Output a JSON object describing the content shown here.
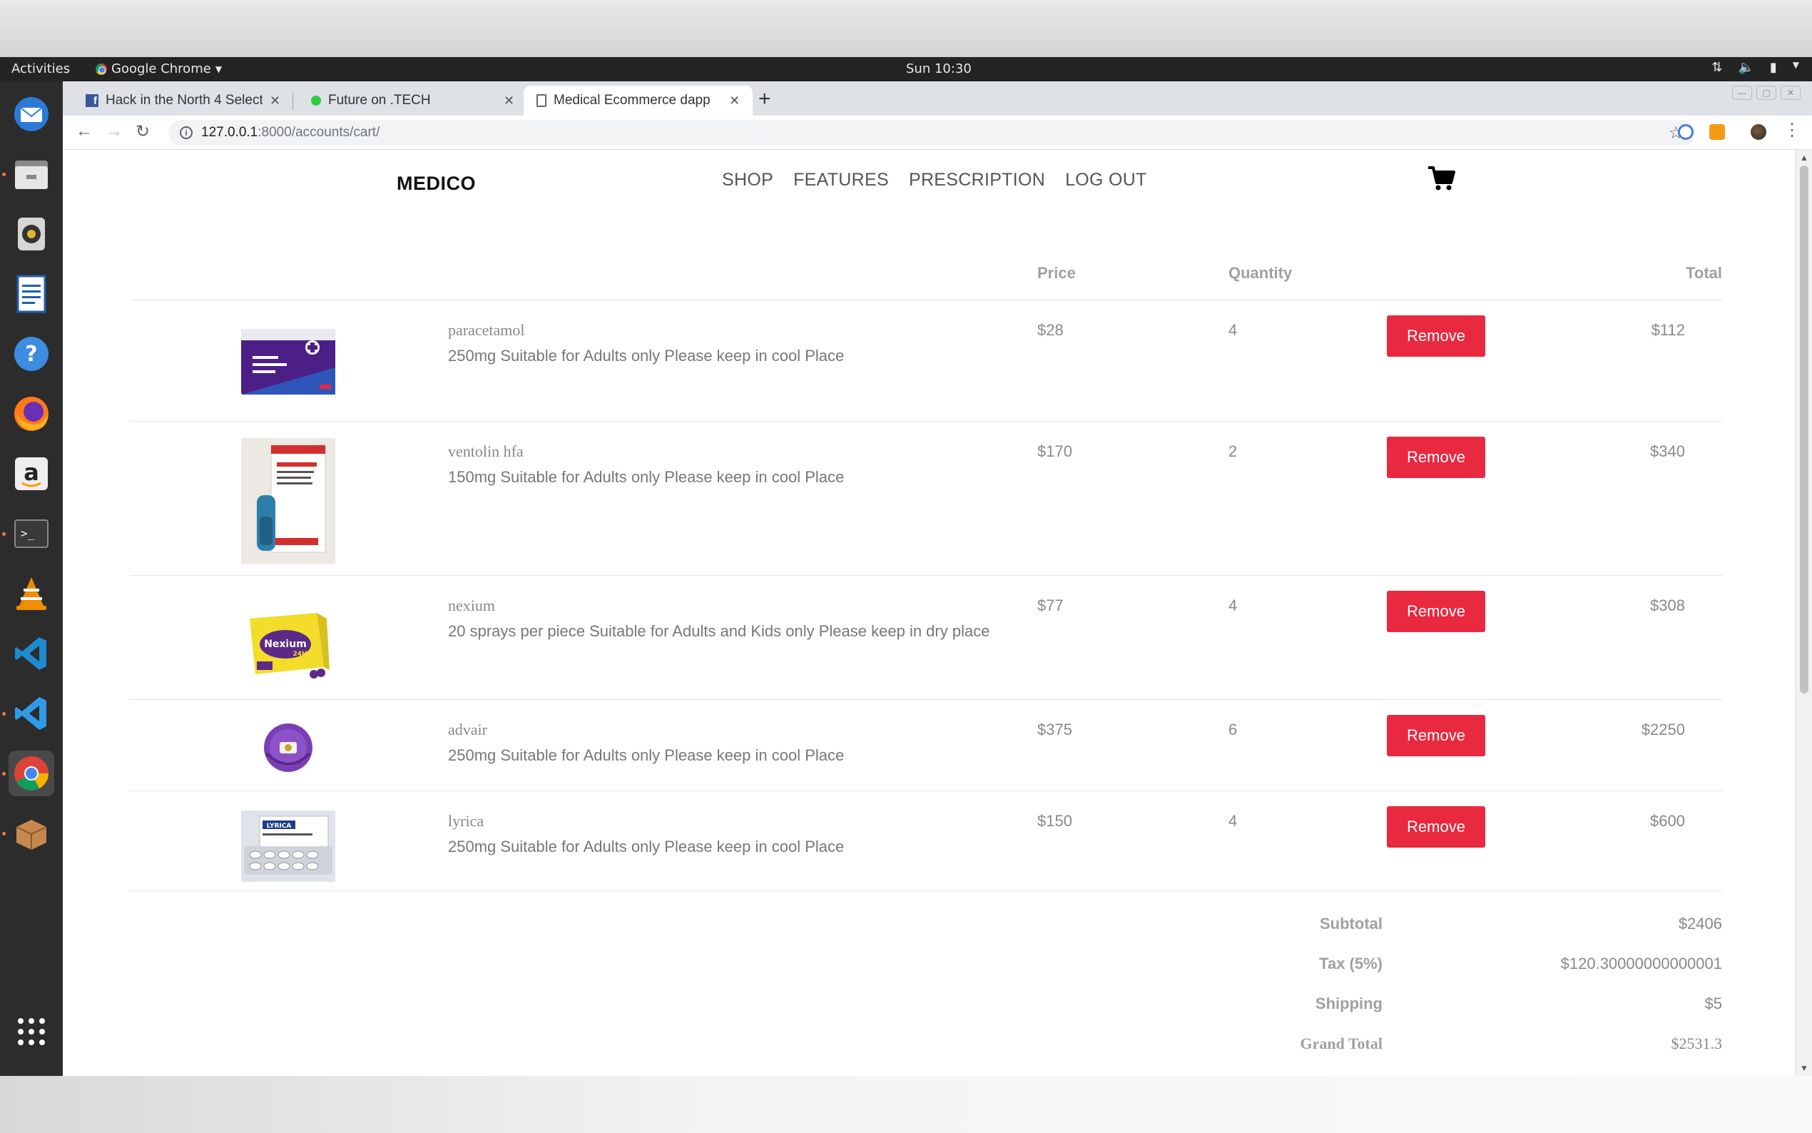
{
  "os": {
    "activities_label": "Activities",
    "app_menu_label": "Google Chrome",
    "clock": "Sun 10:30"
  },
  "dock": {
    "items": [
      "thunderbird-icon",
      "files-icon",
      "rhythmbox-icon",
      "libreoffice-writer-icon",
      "help-icon",
      "firefox-icon",
      "amazon-icon",
      "terminal-icon",
      "vlc-icon",
      "vscode-icon",
      "vscode-insiders-icon",
      "chrome-icon",
      "package-icon",
      "show-apps-icon"
    ]
  },
  "browser": {
    "tabs": [
      {
        "title": "Hack in the North 4 Select",
        "favicon": "facebook-icon"
      },
      {
        "title": "Future on .TECH",
        "favicon": "green-dot-icon"
      },
      {
        "title": "Medical Ecommerce dapp",
        "favicon": "document-icon"
      }
    ],
    "url_host": "127.0.0.1",
    "url_path": ":8000/accounts/cart/"
  },
  "site": {
    "brand": "MEDICO",
    "nav": [
      "SHOP",
      "FEATURES",
      "PRESCRIPTION",
      "LOG OUT"
    ],
    "cart_icon": "shopping-cart-icon"
  },
  "cart": {
    "headers": {
      "price": "Price",
      "quantity": "Quantity",
      "total": "Total"
    },
    "remove_label": "Remove",
    "items": [
      {
        "name": "paracetamol",
        "description": "250mg Suitable for Adults only Please keep in cool Place",
        "price": "$28",
        "quantity": "4",
        "total": "$112",
        "image": "paracetamol-box"
      },
      {
        "name": "ventolin hfa",
        "description": "150mg Suitable for Adults only Please keep in cool Place",
        "price": "$170",
        "quantity": "2",
        "total": "$340",
        "image": "ventolin-inhaler"
      },
      {
        "name": "nexium",
        "description": "20 sprays per piece Suitable for Adults and Kids only Please keep in dry place",
        "price": "$77",
        "quantity": "4",
        "total": "$308",
        "image": "nexium-box"
      },
      {
        "name": "advair",
        "description": "250mg Suitable for Adults only Please keep in cool Place",
        "price": "$375",
        "quantity": "6",
        "total": "$2250",
        "image": "advair-diskus"
      },
      {
        "name": "lyrica",
        "description": "250mg Suitable for Adults only Please keep in cool Place",
        "price": "$150",
        "quantity": "4",
        "total": "$600",
        "image": "lyrica-box"
      }
    ],
    "summary": {
      "subtotal_label": "Subtotal",
      "subtotal": "$2406",
      "tax_label": "Tax (5%)",
      "tax": "$120.30000000000001",
      "shipping_label": "Shipping",
      "shipping": "$5",
      "grand_total_label": "Grand Total",
      "grand_total": "$2531.3"
    }
  }
}
